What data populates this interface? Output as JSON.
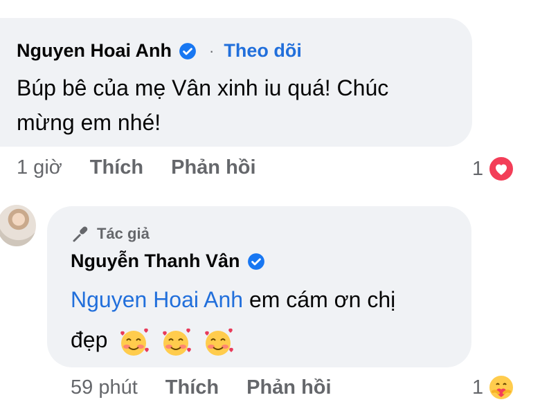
{
  "comment1": {
    "author": "Nguyen Hoai Anh",
    "dot": "·",
    "follow_label": "Theo dõi",
    "text_line1": "Búp bê của mẹ Vân xinh iu quá! Chúc",
    "text_line2": "mừng em nhé!",
    "time": "1 giờ",
    "like_label": "Thích",
    "reply_label": "Phản hồi",
    "reaction_count": "1"
  },
  "comment2": {
    "author_badge": "Tác giả",
    "author": "Nguyễn Thanh Vân",
    "mention": "Nguyen Hoai Anh",
    "text_line1": " em cám ơn chị",
    "text_line2": "đẹp",
    "emojis": [
      "smiling-face-with-hearts",
      "smiling-face-with-hearts",
      "smiling-face-with-hearts"
    ],
    "time": "59 phút",
    "like_label": "Thích",
    "reply_label": "Phản hồi",
    "reaction_count": "1"
  },
  "colors": {
    "bubble": "#f0f2f5",
    "link": "#216fdb",
    "secondary": "#65676b",
    "verified": "#1877f2",
    "love": "#f33e58"
  }
}
